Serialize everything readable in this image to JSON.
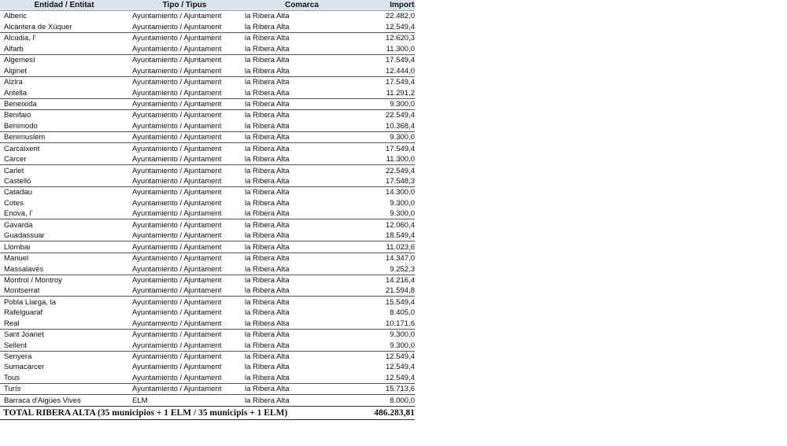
{
  "headers": [
    "Entidad / Entitat",
    "Tipo / Tipus",
    "Comarca",
    "Importe / Imp"
  ],
  "rows": [
    [
      "Alberic",
      "Ayuntamiento / Ajuntament",
      "la Ribera Alta",
      "22.482,0"
    ],
    [
      "Alcàntera de Xúquer",
      "Ayuntamiento / Ajuntament",
      "la Ribera Alta",
      "12.549,4"
    ],
    [
      "Alcúdia, l'",
      "Ayuntamiento / Ajuntament",
      "la Ribera Alta",
      "12.620,3"
    ],
    [
      "Alfarb",
      "Ayuntamiento / Ajuntament",
      "la Ribera Alta",
      "11.300,0"
    ],
    [
      "Algemesí",
      "Ayuntamiento / Ajuntament",
      "la Ribera Alta",
      "17.549,4"
    ],
    [
      "Alginet",
      "Ayuntamiento / Ajuntament",
      "la Ribera Alta",
      "12.444,0"
    ],
    [
      "Alzira",
      "Ayuntamiento / Ajuntament",
      "la Ribera Alta",
      "17.549,4"
    ],
    [
      "Antella",
      "Ayuntamiento / Ajuntament",
      "la Ribera Alta",
      "11.291,2"
    ],
    [
      "Beneixida",
      "Ayuntamiento / Ajuntament",
      "la Ribera Alta",
      "9.300,0"
    ],
    [
      "Benifaió",
      "Ayuntamiento / Ajuntament",
      "la Ribera Alta",
      "22.549,4"
    ],
    [
      "Benimodo",
      "Ayuntamiento / Ajuntament",
      "la Ribera Alta",
      "10.368,4"
    ],
    [
      "Benimuslem",
      "Ayuntamiento / Ajuntament",
      "la Ribera Alta",
      "9.300,0"
    ],
    [
      "Carcaixent",
      "Ayuntamiento / Ajuntament",
      "la Ribera Alta",
      "17.549,4"
    ],
    [
      "Càrcer",
      "Ayuntamiento / Ajuntament",
      "la Ribera Alta",
      "11.300,0"
    ],
    [
      "Carlet",
      "Ayuntamiento / Ajuntament",
      "la Ribera Alta",
      "22.549,4"
    ],
    [
      "Castelló",
      "Ayuntamiento / Ajuntament",
      "la Ribera Alta",
      "17.548,3"
    ],
    [
      "Catadau",
      "Ayuntamiento / Ajuntament",
      "la Ribera Alta",
      "14.300,0"
    ],
    [
      "Cotes",
      "Ayuntamiento / Ajuntament",
      "la Ribera Alta",
      "9.300,0"
    ],
    [
      "Enova, l'",
      "Ayuntamiento / Ajuntament",
      "la Ribera Alta",
      "9.300,0"
    ],
    [
      "Gavarda",
      "Ayuntamiento / Ajuntament",
      "la Ribera Alta",
      "12.060,4"
    ],
    [
      "Guadassuar",
      "Ayuntamiento / Ajuntament",
      "la Ribera Alta",
      "18.549,4"
    ],
    [
      "Llombai",
      "Ayuntamiento / Ajuntament",
      "la Ribera Alta",
      "11.023,6"
    ],
    [
      "Manuel",
      "Ayuntamiento / Ajuntament",
      "la Ribera Alta",
      "14.347,0"
    ],
    [
      "Massalavés",
      "Ayuntamiento / Ajuntament",
      "la Ribera Alta",
      "9.252,3"
    ],
    [
      "Montroi / Montroy",
      "Ayuntamiento / Ajuntament",
      "la Ribera Alta",
      "14.216,4"
    ],
    [
      "Montserrat",
      "Ayuntamiento / Ajuntament",
      "la Ribera Alta",
      "21.594,8"
    ],
    [
      "Pobla Llarga, la",
      "Ayuntamiento / Ajuntament",
      "la Ribera Alta",
      "15.549,4"
    ],
    [
      "Rafelguaraf",
      "Ayuntamiento / Ajuntament",
      "la Ribera Alta",
      "8.405,0"
    ],
    [
      "Real",
      "Ayuntamiento / Ajuntament",
      "la Ribera Alta",
      "10.171,6"
    ],
    [
      "Sant Joanet",
      "Ayuntamiento / Ajuntament",
      "la Ribera Alta",
      "9.300,0"
    ],
    [
      "Sellent",
      "Ayuntamiento / Ajuntament",
      "la Ribera Alta",
      "9.300,0"
    ],
    [
      "Senyera",
      "Ayuntamiento / Ajuntament",
      "la Ribera Alta",
      "12.549,4"
    ],
    [
      "Sumacàrcer",
      "Ayuntamiento / Ajuntament",
      "la Ribera Alta",
      "12.549,4"
    ],
    [
      "Tous",
      "Ayuntamiento / Ajuntament",
      "la Ribera Alta",
      "12.549,4"
    ],
    [
      "Turís",
      "Ayuntamiento / Ajuntament",
      "la Ribera Alta",
      "15.713,6"
    ],
    [
      "Barraca d'Aigües Vives",
      "ELM",
      "la Ribera Alta",
      "8.000,0"
    ]
  ],
  "total": {
    "label": "TOTAL RIBERA ALTA (35 municipios + 1 ELM / 35 municipis + 1 ELM)",
    "value": "486.283,81"
  }
}
